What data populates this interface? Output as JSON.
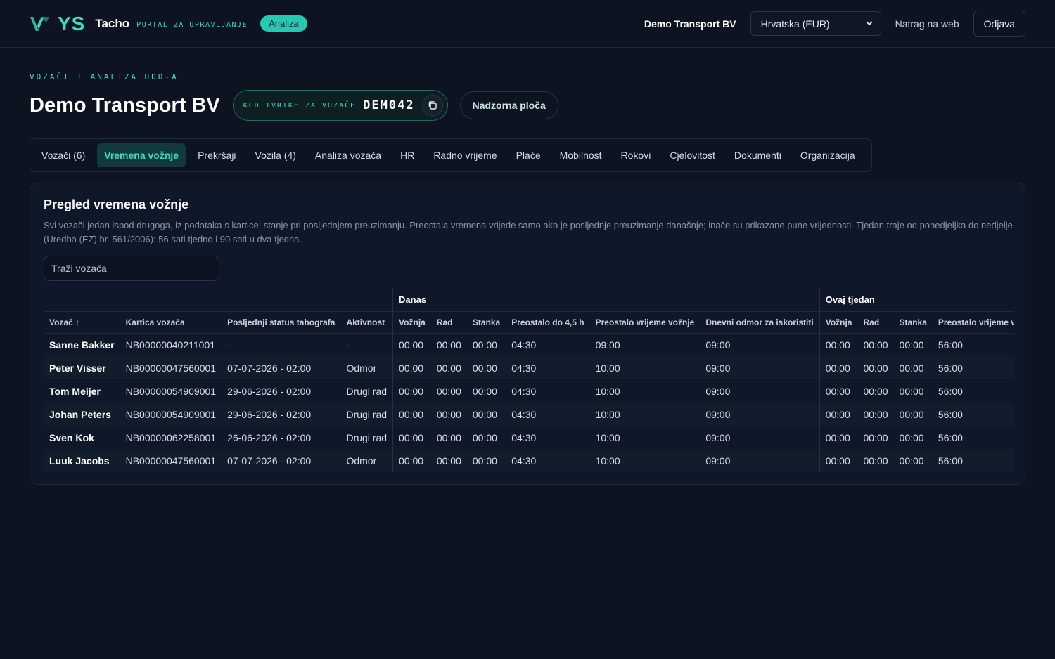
{
  "header": {
    "brand_ys": "YS",
    "brand_name": "Tacho",
    "brand_sub": "PORTAL ZA UPRAVLJANJE",
    "badge": "Analiza",
    "company": "Demo Transport BV",
    "region_select": "Hrvatska (EUR)",
    "back_link": "Natrag na web",
    "logout": "Odjava"
  },
  "page": {
    "eyebrow": "VOZAČI I ANALIZA DDD-A",
    "title": "Demo Transport BV",
    "code_label": "KOD TVRTKE ZA VOZAČE",
    "code_value": "DEM042",
    "dashboard_button": "Nadzorna ploča"
  },
  "tabs": [
    {
      "label": "Vozači (6)",
      "active": false
    },
    {
      "label": "Vremena vožnje",
      "active": true
    },
    {
      "label": "Prekršaji",
      "active": false
    },
    {
      "label": "Vozila (4)",
      "active": false
    },
    {
      "label": "Analiza vozača",
      "active": false
    },
    {
      "label": "HR",
      "active": false
    },
    {
      "label": "Radno vrijeme",
      "active": false
    },
    {
      "label": "Plaće",
      "active": false
    },
    {
      "label": "Mobilnost",
      "active": false
    },
    {
      "label": "Rokovi",
      "active": false
    },
    {
      "label": "Cjelovitost",
      "active": false
    },
    {
      "label": "Dokumenti",
      "active": false
    },
    {
      "label": "Organizacija",
      "active": false
    }
  ],
  "card": {
    "title": "Pregled vremena vožnje",
    "description": "Svi vozači jedan ispod drugoga, iz podataka s kartice: stanje pri posljednjem preuzimanju. Preostala vremena vrijede samo ako je posljednje preuzimanje današnje; inače su prikazane pune vrijednosti. Tjedan traje od ponedjeljka do nedjelje (Uredba (EZ) br. 561/2006): 56 sati tjedno i 90 sati u dva tjedna.",
    "search_placeholder": "Traži vozača"
  },
  "table": {
    "group_today": "Danas",
    "group_week": "Ovaj tjedan",
    "columns": [
      "Vozač ↑",
      "Kartica vozača",
      "Posljednji status tahografa",
      "Aktivnost",
      "Vožnja",
      "Rad",
      "Stanka",
      "Preostalo do 4,5 h",
      "Preostalo vrijeme vožnje",
      "Dnevni odmor za iskoristiti",
      "Vožnja",
      "Rad",
      "Stanka",
      "Preostalo vrijeme v"
    ],
    "rows": [
      [
        "Sanne Bakker",
        "NB00000040211001",
        "-",
        "-",
        "00:00",
        "00:00",
        "00:00",
        "04:30",
        "09:00",
        "09:00",
        "00:00",
        "00:00",
        "00:00",
        "56:00"
      ],
      [
        "Peter Visser",
        "NB00000047560001",
        "07-07-2026 - 02:00",
        "Odmor",
        "00:00",
        "00:00",
        "00:00",
        "04:30",
        "10:00",
        "09:00",
        "00:00",
        "00:00",
        "00:00",
        "56:00"
      ],
      [
        "Tom Meijer",
        "NB00000054909001",
        "29-06-2026 - 02:00",
        "Drugi rad",
        "00:00",
        "00:00",
        "00:00",
        "04:30",
        "10:00",
        "09:00",
        "00:00",
        "00:00",
        "00:00",
        "56:00"
      ],
      [
        "Johan Peters",
        "NB00000054909001",
        "29-06-2026 - 02:00",
        "Drugi rad",
        "00:00",
        "00:00",
        "00:00",
        "04:30",
        "10:00",
        "09:00",
        "00:00",
        "00:00",
        "00:00",
        "56:00"
      ],
      [
        "Sven Kok",
        "NB00000062258001",
        "26-06-2026 - 02:00",
        "Drugi rad",
        "00:00",
        "00:00",
        "00:00",
        "04:30",
        "10:00",
        "09:00",
        "00:00",
        "00:00",
        "00:00",
        "56:00"
      ],
      [
        "Luuk Jacobs",
        "NB00000047560001",
        "07-07-2026 - 02:00",
        "Odmor",
        "00:00",
        "00:00",
        "00:00",
        "04:30",
        "10:00",
        "09:00",
        "00:00",
        "00:00",
        "00:00",
        "56:00"
      ]
    ]
  },
  "colors": {
    "accent": "#3fd9c2",
    "background": "#0d1320",
    "card": "#0f1828"
  }
}
